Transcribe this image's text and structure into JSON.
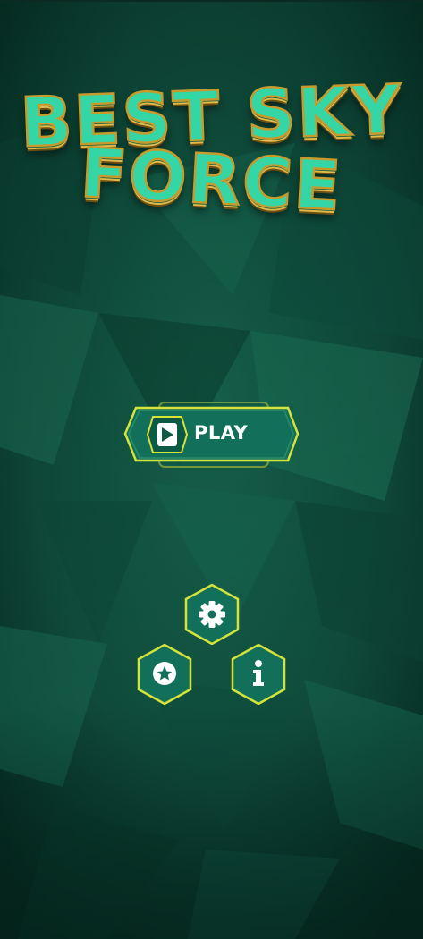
{
  "game": {
    "title_line1": "BEST SKY",
    "title_line2": "FORCE"
  },
  "menu": {
    "play_label": "PLAY",
    "icons": {
      "play": "play-icon",
      "settings": "gear-icon",
      "favorites": "star-icon",
      "info": "info-icon"
    }
  },
  "colors": {
    "background": "#0b3f31",
    "button_fill": "#12705a",
    "button_border": "#d6e33a",
    "title_fill": "#34d6a6",
    "title_outline": "#c79a2c"
  }
}
